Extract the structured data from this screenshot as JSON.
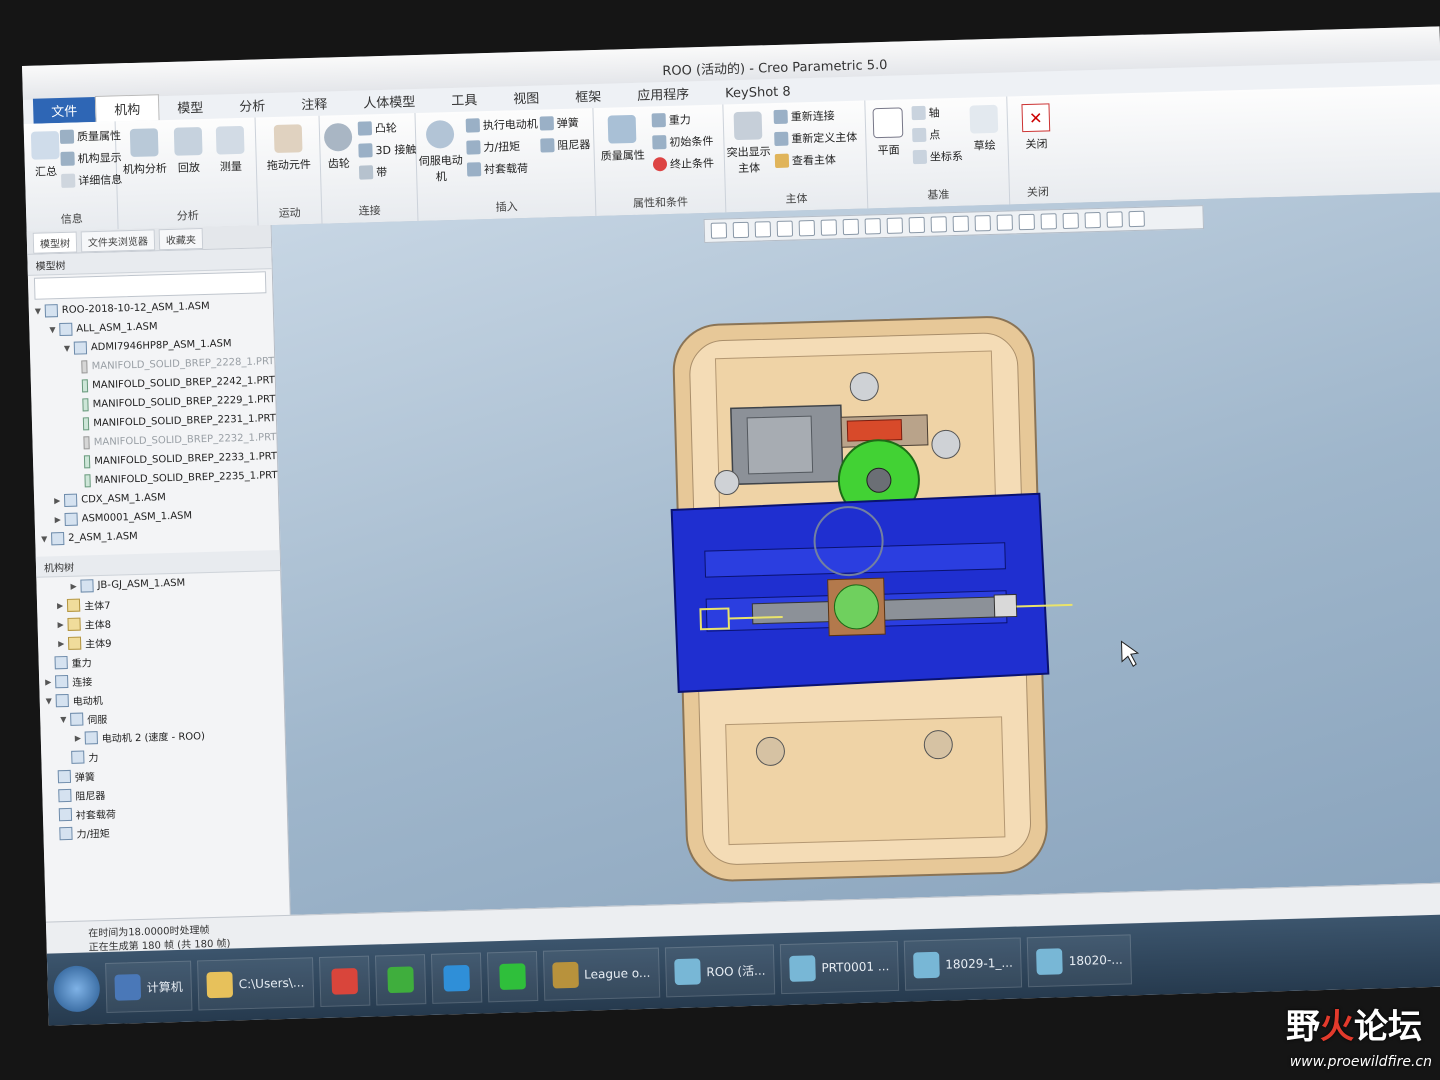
{
  "window": {
    "title": "ROO (活动的) - Creo Parametric 5.0"
  },
  "tabs": [
    "文件",
    "机构",
    "模型",
    "分析",
    "注释",
    "人体模型",
    "工具",
    "视图",
    "框架",
    "应用程序",
    "KeyShot 8"
  ],
  "ribbon": {
    "info": {
      "label": "信息",
      "btn_summary": "汇总",
      "btn_mass": "质量属性",
      "btn_display": "机构显示",
      "btn_detail": "详细信息"
    },
    "analysis": {
      "label": "分析",
      "btn_mech": "机构分析",
      "btn_playback": "回放",
      "btn_measure": "测量"
    },
    "motion": {
      "label": "运动",
      "btn_drag": "拖动元件"
    },
    "connect": {
      "label": "连接",
      "btn_gear": "齿轮",
      "btn_cam": "凸轮",
      "btn_3d": "3D 接触",
      "btn_belt": "带"
    },
    "insert": {
      "label": "插入",
      "btn_servo": "伺服电动机",
      "btn_exec": "执行电动机",
      "btn_force": "力/扭矩",
      "btn_bushing": "衬套载荷",
      "btn_spring": "弹簧",
      "btn_damper": "阻尼器"
    },
    "props": {
      "label": "属性和条件",
      "btn_mass": "质量属性",
      "btn_gravity": "重力",
      "btn_init": "初始条件",
      "btn_term": "终止条件"
    },
    "body": {
      "label": "主体",
      "btn_highlight": "突出显示主体",
      "btn_reconnect": "重新连接",
      "btn_redefine": "重新定义主体",
      "btn_view": "查看主体"
    },
    "datum": {
      "label": "基准",
      "btn_plane": "平面",
      "btn_axis": "轴",
      "btn_point": "点",
      "btn_csys": "坐标系",
      "btn_sketch": "草绘"
    },
    "close": {
      "label": "关闭",
      "btn_close": "关闭"
    }
  },
  "left_panel": {
    "tabs": [
      "模型树",
      "文件夹浏览器",
      "收藏夹"
    ],
    "model_tree_label": "模型树",
    "model_tree": [
      {
        "text": "ROO-2018-10-12_ASM_1.ASM",
        "level": 0,
        "type": "asm",
        "tw": "▼"
      },
      {
        "text": "ALL_ASM_1.ASM",
        "level": 1,
        "type": "asm",
        "tw": "▼"
      },
      {
        "text": "ADMI7946HP8P_ASM_1.ASM",
        "level": 2,
        "type": "asm",
        "tw": "▼"
      },
      {
        "text": "MANIFOLD_SOLID_BREP_2228_1.PRT",
        "level": 3,
        "type": "gray",
        "dim": true,
        "tw": ""
      },
      {
        "text": "MANIFOLD_SOLID_BREP_2242_1.PRT",
        "level": 3,
        "type": "part",
        "tw": ""
      },
      {
        "text": "MANIFOLD_SOLID_BREP_2229_1.PRT",
        "level": 3,
        "type": "part",
        "tw": ""
      },
      {
        "text": "MANIFOLD_SOLID_BREP_2231_1.PRT",
        "level": 3,
        "type": "part",
        "tw": ""
      },
      {
        "text": "MANIFOLD_SOLID_BREP_2232_1.PRT",
        "level": 3,
        "type": "gray",
        "dim": true,
        "tw": ""
      },
      {
        "text": "MANIFOLD_SOLID_BREP_2233_1.PRT",
        "level": 3,
        "type": "part",
        "tw": ""
      },
      {
        "text": "MANIFOLD_SOLID_BREP_2235_1.PRT",
        "level": 3,
        "type": "part",
        "tw": ""
      },
      {
        "text": "CDX_ASM_1.ASM",
        "level": 1,
        "type": "asm",
        "tw": "▶"
      },
      {
        "text": "ASM0001_ASM_1.ASM",
        "level": 1,
        "type": "asm",
        "tw": "▶"
      },
      {
        "text": "2_ASM_1.ASM",
        "level": 0,
        "type": "asm",
        "tw": "▼"
      }
    ],
    "mech_tree_label": "机构树",
    "mech_tree": [
      {
        "text": "JB-GJ_ASM_1.ASM",
        "level": 2,
        "type": "asm",
        "tw": "▶"
      },
      {
        "text": "主体7",
        "level": 1,
        "type": "fold",
        "tw": "▶"
      },
      {
        "text": "主体8",
        "level": 1,
        "type": "fold",
        "tw": "▶"
      },
      {
        "text": "主体9",
        "level": 1,
        "type": "fold",
        "tw": "▶"
      },
      {
        "text": "重力",
        "level": 0,
        "type": "asm",
        "tw": ""
      },
      {
        "text": "连接",
        "level": 0,
        "type": "asm",
        "tw": "▶"
      },
      {
        "text": "电动机",
        "level": 0,
        "type": "asm",
        "tw": "▼"
      },
      {
        "text": "伺服",
        "level": 1,
        "type": "asm",
        "tw": "▼"
      },
      {
        "text": "电动机 2 (速度 - ROO)",
        "level": 2,
        "type": "asm",
        "tw": "▶"
      },
      {
        "text": "力",
        "level": 1,
        "type": "asm",
        "tw": ""
      },
      {
        "text": "弹簧",
        "level": 0,
        "type": "asm",
        "tw": ""
      },
      {
        "text": "阻尼器",
        "level": 0,
        "type": "asm",
        "tw": ""
      },
      {
        "text": "衬套载荷",
        "level": 0,
        "type": "asm",
        "tw": ""
      },
      {
        "text": "力/扭矩",
        "level": 0,
        "type": "asm",
        "tw": ""
      }
    ]
  },
  "status": {
    "line1": "在时间为18.0000时处理帧",
    "line2": "正在生成第 180 帧 (共 180 帧)"
  },
  "taskbar": {
    "items": [
      {
        "label": "计算机",
        "icon": "computer-icon",
        "color": "#4a78b8"
      },
      {
        "label": "C:\\Users\\...",
        "icon": "folder-icon",
        "color": "#e7c15b"
      },
      {
        "label": "",
        "icon": "chrome-icon",
        "color": "#d9453b"
      },
      {
        "label": "",
        "icon": "green-browser-icon",
        "color": "#3fae3d"
      },
      {
        "label": "",
        "icon": "ie-icon",
        "color": "#2f8fd8"
      },
      {
        "label": "",
        "icon": "iqiyi-icon",
        "color": "#2fbf3b"
      },
      {
        "label": "League o...",
        "icon": "league-icon",
        "color": "#b8923c"
      },
      {
        "label": "ROO (活...",
        "icon": "creo-icon",
        "color": "#78b7d6"
      },
      {
        "label": "PRT0001 ...",
        "icon": "creo-icon",
        "color": "#78b7d6"
      },
      {
        "label": "18029-1_...",
        "icon": "creo-icon",
        "color": "#78b7d6"
      },
      {
        "label": "18020-...",
        "icon": "creo-icon",
        "color": "#78b7d6"
      }
    ]
  },
  "watermark": {
    "text_a": "野",
    "text_b": "火",
    "text_c": "论坛",
    "url": "www.proewildfire.cn"
  },
  "colors": {
    "blue_part": "#1f2fd0",
    "green_gear": "#39d62f",
    "housing": "#f1d6ad",
    "motor": "#8a8f96"
  }
}
